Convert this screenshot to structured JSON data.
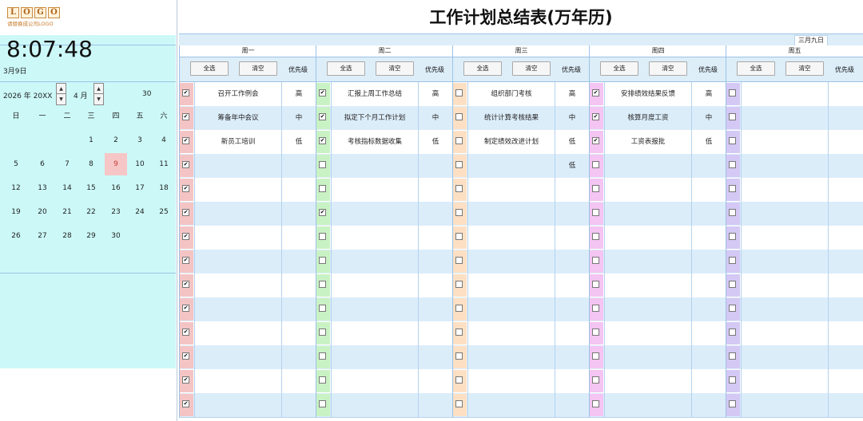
{
  "logo": {
    "letters": [
      "L",
      "O",
      "G",
      "O"
    ],
    "subtitle": "请替换成公司LOGO"
  },
  "clock": {
    "time": "8:07:48",
    "date": "3月9日"
  },
  "selector": {
    "year": "2026 年 20XX",
    "month": "4 月",
    "last_day": "30"
  },
  "calendar": {
    "weekdays": [
      "日",
      "一",
      "二",
      "三",
      "四",
      "五",
      "六"
    ],
    "weeks": [
      [
        "",
        "",
        "",
        "1",
        "2",
        "3",
        "4"
      ],
      [
        "5",
        "6",
        "7",
        "8",
        "9",
        "10",
        "11"
      ],
      [
        "12",
        "13",
        "14",
        "15",
        "16",
        "17",
        "18"
      ],
      [
        "19",
        "20",
        "21",
        "22",
        "23",
        "24",
        "25"
      ],
      [
        "26",
        "27",
        "28",
        "29",
        "30",
        "",
        ""
      ]
    ],
    "today": "9"
  },
  "title": "工作计划总结表(万年历)",
  "lunar_date": "三月九日",
  "buttons": {
    "select_all": "全选",
    "clear": "清空"
  },
  "priority_header": "优先级",
  "colors": {
    "mon": "#f4c4c4",
    "tue": "#c9f2c4",
    "wed": "#fde0c4",
    "thu": "#f4c4f2",
    "fri": "#d4c8f4",
    "accent": "#9cc2e6",
    "today": "#f6c6c6"
  },
  "days": [
    {
      "name": "周一",
      "color": "mon",
      "rows": [
        {
          "checked": true,
          "task": "召开工作例会",
          "level": "高"
        },
        {
          "checked": true,
          "task": "筹备年中会议",
          "level": "中"
        },
        {
          "checked": true,
          "task": "新员工培训",
          "level": "低"
        },
        {
          "checked": true,
          "task": "",
          "level": ""
        },
        {
          "checked": true,
          "task": "",
          "level": ""
        },
        {
          "checked": true,
          "task": "",
          "level": ""
        },
        {
          "checked": true,
          "task": "",
          "level": ""
        },
        {
          "checked": true,
          "task": "",
          "level": ""
        },
        {
          "checked": true,
          "task": "",
          "level": ""
        },
        {
          "checked": true,
          "task": "",
          "level": ""
        },
        {
          "checked": true,
          "task": "",
          "level": ""
        },
        {
          "checked": true,
          "task": "",
          "level": ""
        },
        {
          "checked": true,
          "task": "",
          "level": ""
        },
        {
          "checked": true,
          "task": "",
          "level": ""
        }
      ]
    },
    {
      "name": "周二",
      "color": "tue",
      "rows": [
        {
          "checked": true,
          "task": "汇报上周工作总结",
          "level": "高"
        },
        {
          "checked": true,
          "task": "拟定下个月工作计划",
          "level": "中"
        },
        {
          "checked": true,
          "task": "考核指标数据收集",
          "level": "低"
        },
        {
          "checked": false,
          "task": "",
          "level": ""
        },
        {
          "checked": false,
          "task": "",
          "level": ""
        },
        {
          "checked": true,
          "task": "",
          "level": ""
        },
        {
          "checked": false,
          "task": "",
          "level": ""
        },
        {
          "checked": false,
          "task": "",
          "level": ""
        },
        {
          "checked": false,
          "task": "",
          "level": ""
        },
        {
          "checked": false,
          "task": "",
          "level": ""
        },
        {
          "checked": false,
          "task": "",
          "level": ""
        },
        {
          "checked": false,
          "task": "",
          "level": ""
        },
        {
          "checked": false,
          "task": "",
          "level": ""
        },
        {
          "checked": false,
          "task": "",
          "level": ""
        }
      ]
    },
    {
      "name": "周三",
      "color": "wed",
      "rows": [
        {
          "checked": false,
          "task": "组织部门考核",
          "level": "高"
        },
        {
          "checked": false,
          "task": "统计计算考核结果",
          "level": "中"
        },
        {
          "checked": false,
          "task": "制定绩效改进计划",
          "level": "低"
        },
        {
          "checked": false,
          "task": "",
          "level": "低"
        },
        {
          "checked": false,
          "task": "",
          "level": ""
        },
        {
          "checked": false,
          "task": "",
          "level": ""
        },
        {
          "checked": false,
          "task": "",
          "level": ""
        },
        {
          "checked": false,
          "task": "",
          "level": ""
        },
        {
          "checked": false,
          "task": "",
          "level": ""
        },
        {
          "checked": false,
          "task": "",
          "level": ""
        },
        {
          "checked": false,
          "task": "",
          "level": ""
        },
        {
          "checked": false,
          "task": "",
          "level": ""
        },
        {
          "checked": false,
          "task": "",
          "level": ""
        },
        {
          "checked": false,
          "task": "",
          "level": ""
        }
      ]
    },
    {
      "name": "周四",
      "color": "thu",
      "rows": [
        {
          "checked": true,
          "task": "安排绩效结果反馈",
          "level": "高"
        },
        {
          "checked": true,
          "task": "核算月度工资",
          "level": "中"
        },
        {
          "checked": true,
          "task": "工资表报批",
          "level": "低"
        },
        {
          "checked": false,
          "task": "",
          "level": ""
        },
        {
          "checked": false,
          "task": "",
          "level": ""
        },
        {
          "checked": false,
          "task": "",
          "level": ""
        },
        {
          "checked": false,
          "task": "",
          "level": ""
        },
        {
          "checked": false,
          "task": "",
          "level": ""
        },
        {
          "checked": false,
          "task": "",
          "level": ""
        },
        {
          "checked": false,
          "task": "",
          "level": ""
        },
        {
          "checked": false,
          "task": "",
          "level": ""
        },
        {
          "checked": false,
          "task": "",
          "level": ""
        },
        {
          "checked": false,
          "task": "",
          "level": ""
        },
        {
          "checked": false,
          "task": "",
          "level": ""
        }
      ]
    },
    {
      "name": "周五",
      "color": "fri",
      "rows": [
        {
          "checked": false,
          "task": "",
          "level": ""
        },
        {
          "checked": false,
          "task": "",
          "level": ""
        },
        {
          "checked": false,
          "task": "",
          "level": ""
        },
        {
          "checked": false,
          "task": "",
          "level": ""
        },
        {
          "checked": false,
          "task": "",
          "level": ""
        },
        {
          "checked": false,
          "task": "",
          "level": ""
        },
        {
          "checked": false,
          "task": "",
          "level": ""
        },
        {
          "checked": false,
          "task": "",
          "level": ""
        },
        {
          "checked": false,
          "task": "",
          "level": ""
        },
        {
          "checked": false,
          "task": "",
          "level": ""
        },
        {
          "checked": false,
          "task": "",
          "level": ""
        },
        {
          "checked": false,
          "task": "",
          "level": ""
        },
        {
          "checked": false,
          "task": "",
          "level": ""
        },
        {
          "checked": false,
          "task": "",
          "level": ""
        }
      ]
    }
  ]
}
